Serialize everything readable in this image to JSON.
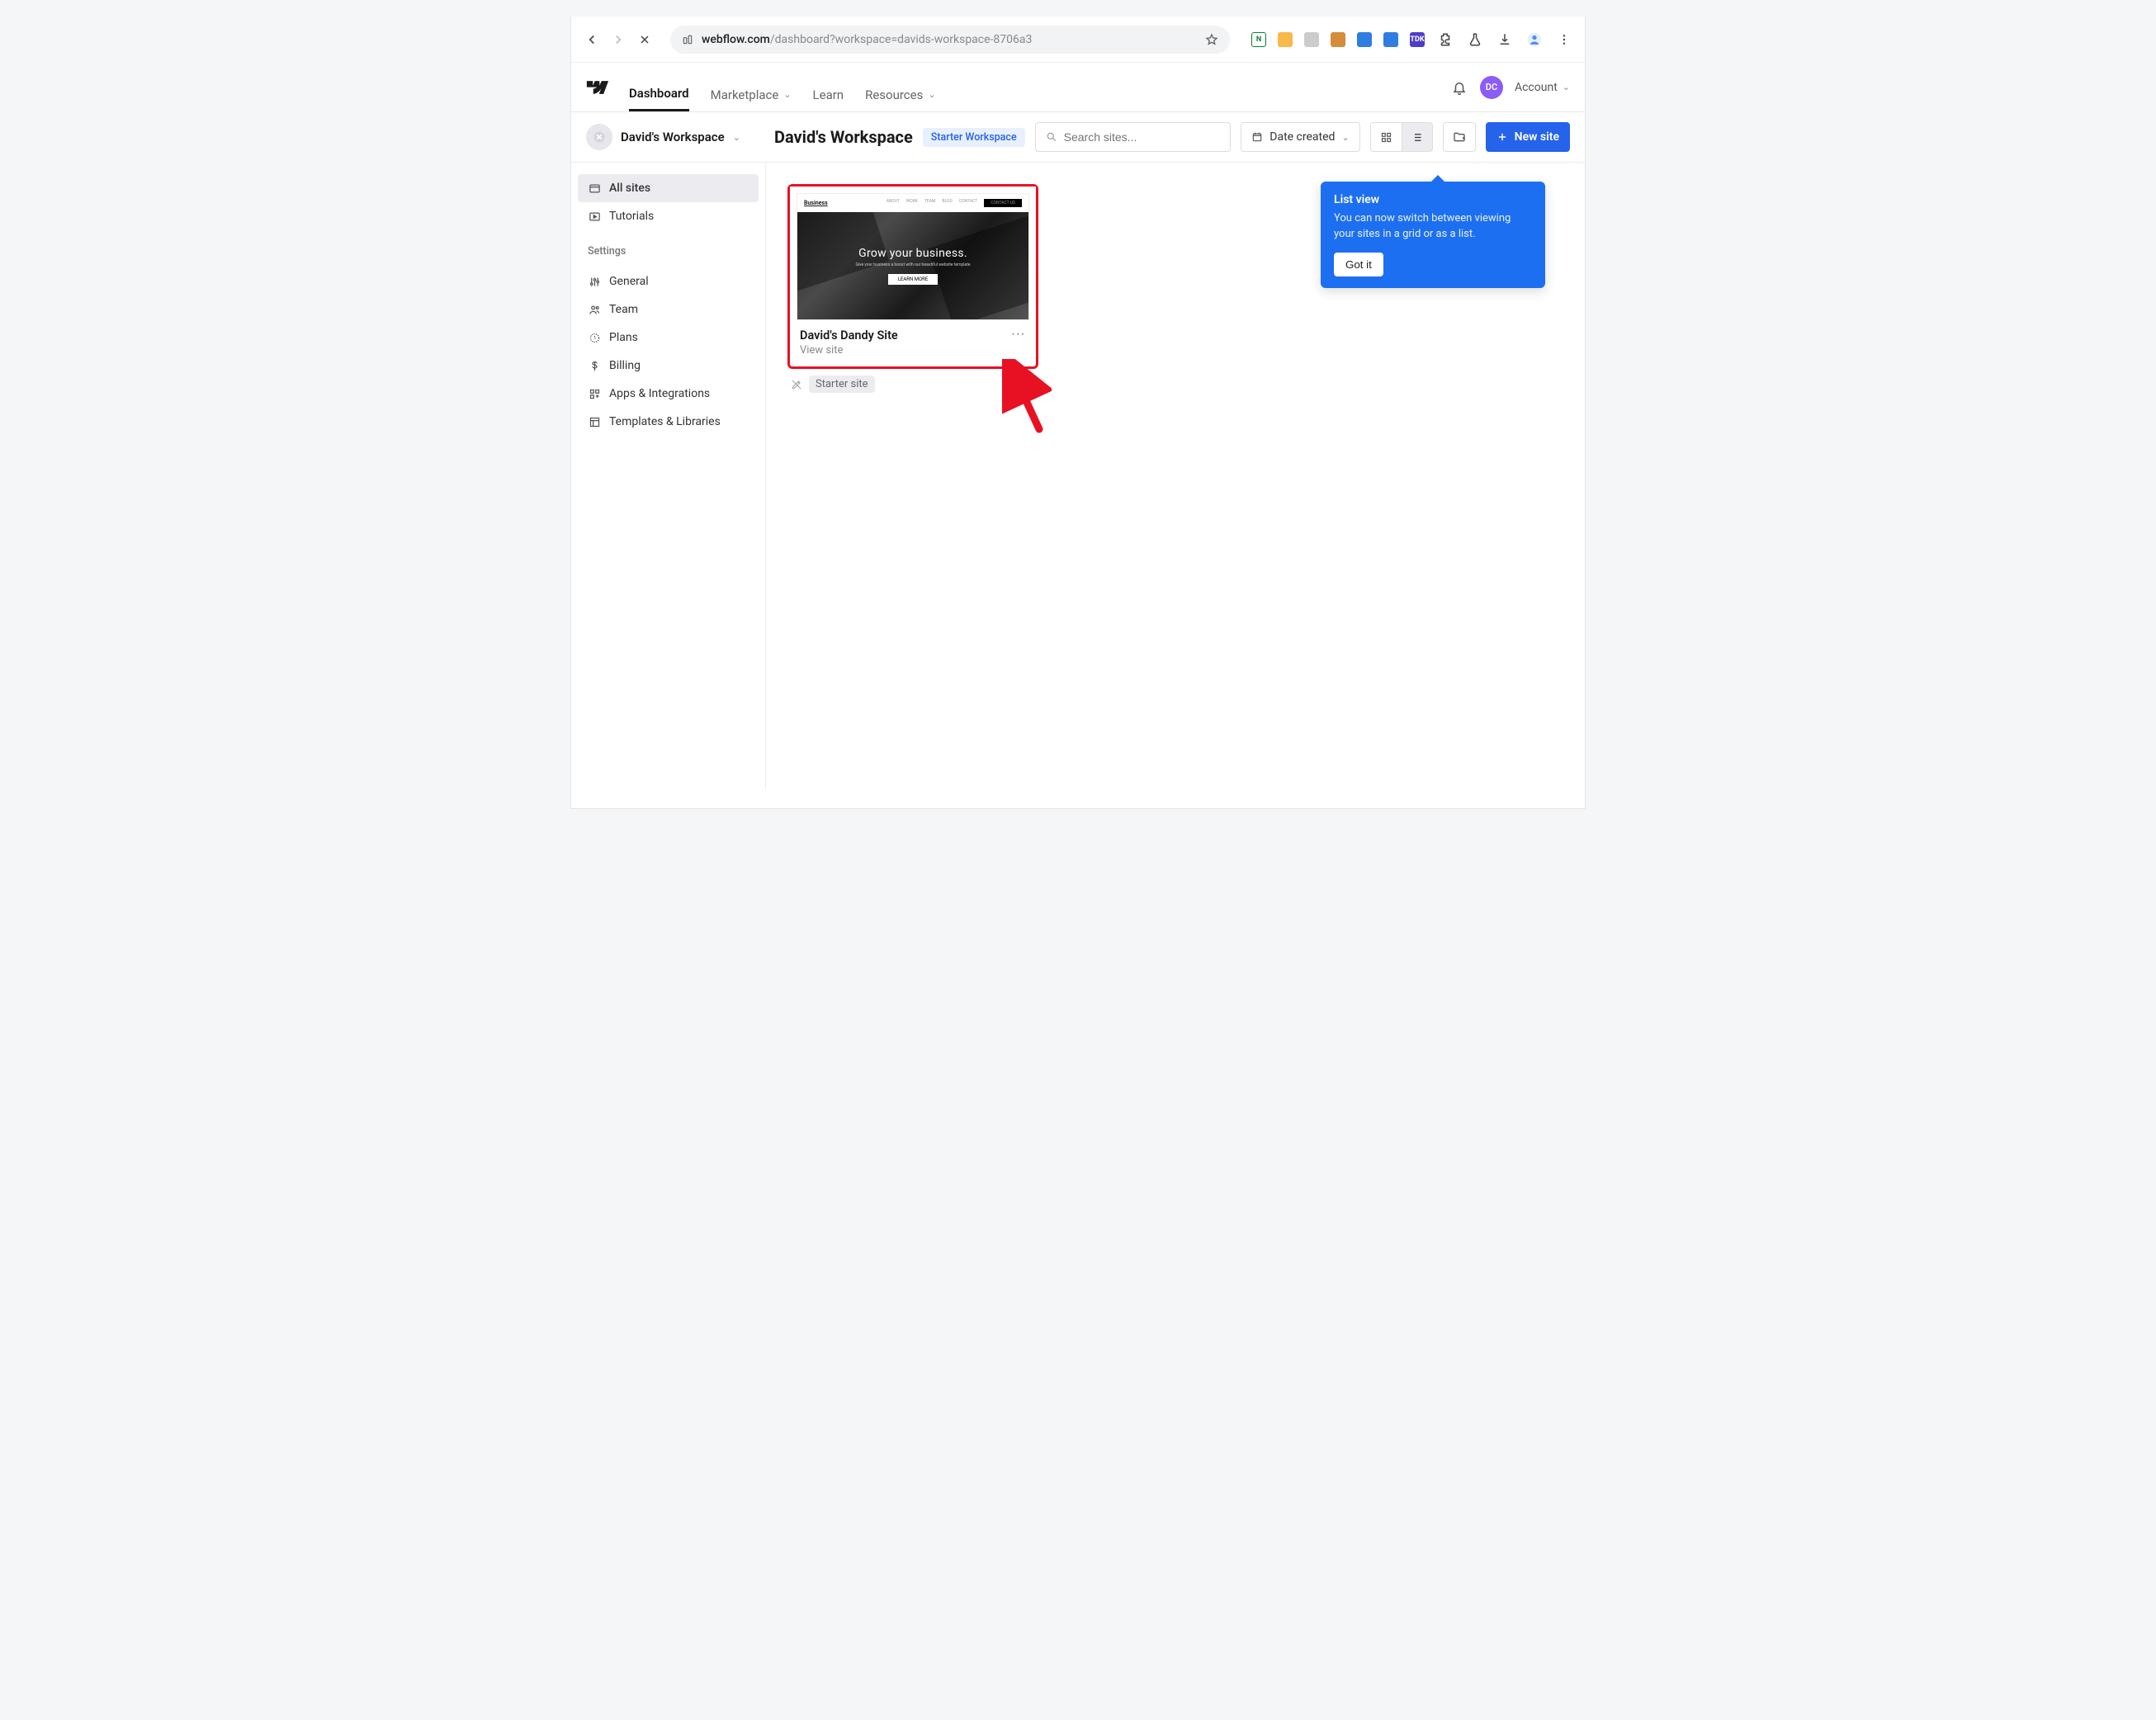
{
  "browser": {
    "url_host": "webflow.com",
    "url_path": "/dashboard?workspace=davids-workspace-8706a3",
    "ext_labels": [
      "N",
      "",
      "",
      "",
      "",
      "",
      "TDK"
    ]
  },
  "header": {
    "nav": {
      "dashboard": "Dashboard",
      "marketplace": "Marketplace",
      "learn": "Learn",
      "resources": "Resources"
    },
    "avatar_initials": "DC",
    "account_label": "Account"
  },
  "toolbar": {
    "workspace_switch_name": "David's Workspace",
    "page_title": "David's Workspace",
    "badge": "Starter Workspace",
    "search_placeholder": "Search sites...",
    "sort_label": "Date created",
    "new_site_label": "New site"
  },
  "sidebar": {
    "group1": [
      {
        "icon": "browser",
        "label": "All sites",
        "active": true
      },
      {
        "icon": "play",
        "label": "Tutorials",
        "active": false
      }
    ],
    "settings_heading": "Settings",
    "group2": [
      {
        "icon": "sliders",
        "label": "General"
      },
      {
        "icon": "users",
        "label": "Team"
      },
      {
        "icon": "target",
        "label": "Plans"
      },
      {
        "icon": "dollar",
        "label": "Billing"
      },
      {
        "icon": "apps",
        "label": "Apps & Integrations"
      },
      {
        "icon": "template",
        "label": "Templates & Libraries"
      }
    ]
  },
  "site_card": {
    "thumb": {
      "logo": "Business",
      "headline": "Grow your business.",
      "button": "LEARN MORE"
    },
    "title": "David's Dandy Site",
    "view_link": "View site",
    "tag": "Starter site"
  },
  "popover": {
    "title": "List view",
    "body": "You can now switch between viewing your sites in a grid or as a list.",
    "button": "Got it"
  }
}
